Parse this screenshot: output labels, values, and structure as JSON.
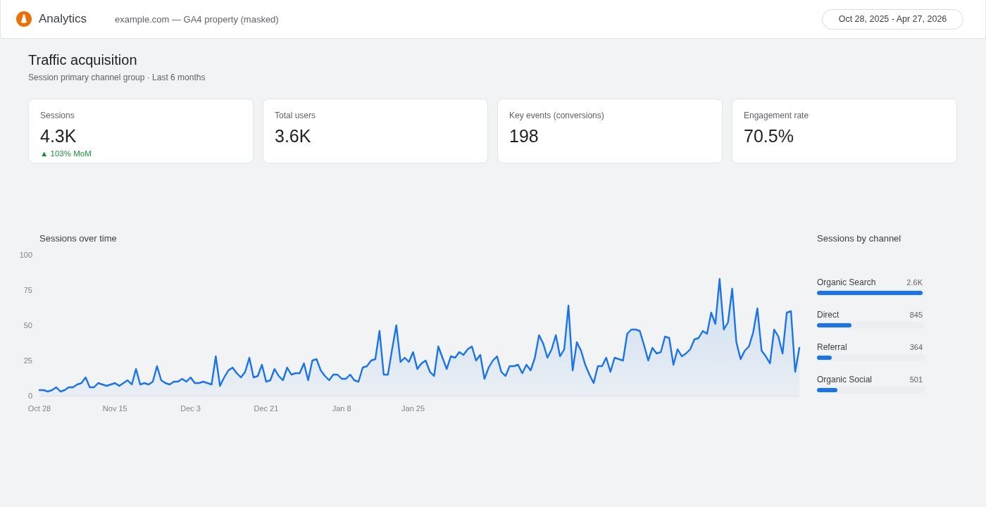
{
  "header": {
    "app_name": "Analytics",
    "property": "example.com — GA4 property (masked)",
    "date_range": "Oct 28, 2025 - Apr 27, 2026"
  },
  "page": {
    "title": "Traffic acquisition",
    "subtitle": "Session primary channel group · Last 6 months"
  },
  "kpis": [
    {
      "label": "Sessions",
      "value": "4.3K",
      "delta": "▲ 103% MoM",
      "positive": true
    },
    {
      "label": "Total users",
      "value": "3.6K"
    },
    {
      "label": "Key events (conversions)",
      "value": "198"
    },
    {
      "label": "Engagement rate",
      "value": "70.5%"
    }
  ],
  "sessions_over_time": {
    "chart_data": {
      "type": "area",
      "title": "Sessions over time",
      "categories": [
        "Oct 28",
        null,
        null,
        null,
        null,
        null,
        null,
        null,
        null,
        null,
        null,
        null,
        null,
        null,
        null,
        null,
        null,
        null,
        "Nov 15",
        null,
        null,
        null,
        null,
        null,
        null,
        null,
        null,
        null,
        null,
        null,
        null,
        null,
        null,
        null,
        null,
        null,
        "Dec 3",
        null,
        null,
        null,
        null,
        null,
        null,
        null,
        null,
        null,
        null,
        null,
        null,
        null,
        null,
        null,
        null,
        null,
        "Dec 21",
        null,
        null,
        null,
        null,
        null,
        null,
        null,
        null,
        null,
        null,
        null,
        null,
        null,
        null,
        null,
        null,
        null,
        "Jan 8",
        null,
        null,
        null,
        null,
        null,
        null,
        null,
        null,
        null,
        null,
        null,
        null,
        null,
        null,
        null,
        null,
        "Jan 25",
        null,
        null,
        null,
        null,
        null,
        null,
        null,
        null,
        null,
        null,
        null,
        null,
        null,
        null,
        null,
        null,
        null,
        null,
        null,
        null,
        null,
        null,
        null,
        null,
        null,
        null,
        null,
        null,
        null,
        null,
        null,
        null,
        null,
        null,
        null,
        null,
        null,
        null,
        null,
        null,
        null,
        null,
        null,
        null,
        null,
        null,
        null,
        null,
        null,
        null,
        null,
        null,
        null,
        null,
        null,
        null,
        null,
        null,
        null,
        null,
        null,
        null,
        null,
        null,
        null,
        null,
        null,
        null,
        null,
        null,
        null,
        null,
        null,
        null,
        null,
        null,
        null,
        null,
        null,
        null,
        null,
        null,
        null,
        null,
        null,
        null,
        null,
        null,
        null,
        null,
        null,
        null
      ],
      "ylim": [
        0,
        100
      ],
      "yticks": [
        0,
        25,
        50,
        75,
        100
      ],
      "values": [
        4,
        4,
        3,
        4,
        6,
        3,
        4,
        6,
        6,
        8,
        9,
        13,
        6,
        6,
        9,
        8,
        7,
        8,
        9,
        7,
        9,
        11,
        8,
        19,
        8,
        9,
        8,
        10,
        21,
        11,
        9,
        8,
        10,
        10,
        12,
        10,
        13,
        9,
        9,
        10,
        9,
        8,
        28,
        7,
        13,
        18,
        20,
        16,
        13,
        17,
        27,
        13,
        14,
        22,
        10,
        11,
        19,
        14,
        11,
        20,
        15,
        16,
        16,
        23,
        11,
        25,
        26,
        18,
        14,
        11,
        15,
        15,
        12,
        12,
        15,
        11,
        10,
        20,
        21,
        25,
        26,
        46,
        15,
        15,
        33,
        50,
        24,
        27,
        24,
        31,
        19,
        23,
        25,
        17,
        14,
        35,
        27,
        19,
        28,
        27,
        31,
        29,
        33,
        35,
        25,
        29,
        12,
        20,
        25,
        28,
        17,
        14,
        21,
        21,
        22,
        16,
        22,
        18,
        27,
        43,
        37,
        27,
        33,
        43,
        28,
        33,
        64,
        18,
        38,
        32,
        22,
        15,
        9,
        21,
        21,
        27,
        17,
        27,
        26,
        25,
        44,
        47,
        47,
        46,
        36,
        25,
        34,
        30,
        31,
        42,
        41,
        22,
        33,
        28,
        30,
        33,
        40,
        41,
        46,
        44,
        59,
        51,
        83,
        47,
        52,
        76,
        38,
        26,
        32,
        35,
        45,
        62,
        32,
        28,
        23,
        47,
        42,
        30,
        59,
        60,
        17,
        34
      ]
    }
  },
  "channels": {
    "title": "Sessions by channel",
    "items": [
      {
        "name": "Organic Search",
        "reading": "2.6K",
        "level": 1
      },
      {
        "name": "Direct",
        "reading": "845",
        "level": 0.325
      },
      {
        "name": "Referral",
        "reading": "364",
        "level": 0.14
      },
      {
        "name": "Organic Social",
        "reading": "501",
        "level": 0.193
      }
    ]
  }
}
